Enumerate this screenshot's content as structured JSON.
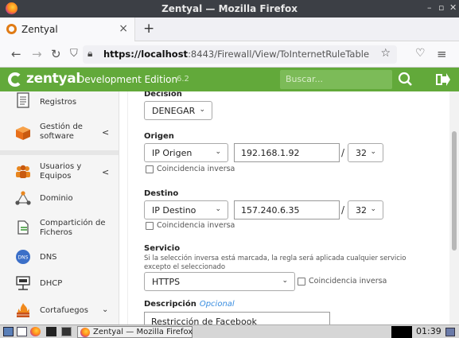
{
  "window": {
    "title": "Zentyal — Mozilla Firefox"
  },
  "browser": {
    "tab_label": "Zentyal",
    "tab_close": "×",
    "new_tab": "+",
    "url_host": "https://localhost",
    "url_path": ":8443/Firewall/View/ToInternetRuleTable"
  },
  "header": {
    "brand": "zentyal",
    "edition": "Development Edition",
    "version": "6.2",
    "search_placeholder": "Buscar..."
  },
  "sidebar": {
    "items": [
      {
        "label": "Registros",
        "icon": "registry-icon",
        "chevron": false
      },
      {
        "label": "Gestión de\nsoftware",
        "icon": "software-box-icon",
        "chevron": true
      },
      {
        "label": "Usuarios y\nEquipos",
        "icon": "users-icon",
        "chevron": true
      },
      {
        "label": "Dominio",
        "icon": "domain-network-icon",
        "chevron": false
      },
      {
        "label": "Compartición de\nFicheros",
        "icon": "file-share-icon",
        "chevron": false
      },
      {
        "label": "DNS",
        "icon": "dns-icon",
        "chevron": false
      },
      {
        "label": "DHCP",
        "icon": "dhcp-icon",
        "chevron": false
      },
      {
        "label": "Cortafuegos",
        "icon": "firewall-icon",
        "chevron": true
      }
    ]
  },
  "form": {
    "decision": {
      "label": "Decisión",
      "value": "DENEGAR"
    },
    "origen": {
      "label": "Origen",
      "type": "IP Origen",
      "ip": "192.168.1.92",
      "slash": "/",
      "mask": "32",
      "inverse_label": "Coincidencia inversa"
    },
    "destino": {
      "label": "Destino",
      "type": "IP Destino",
      "ip": "157.240.6.35",
      "slash": "/",
      "mask": "32",
      "inverse_label": "Coincidencia inversa"
    },
    "servicio": {
      "label": "Servicio",
      "help": "Si la selección inversa está marcada, la regla será aplicada cualquier servicio excepto el seleccionado",
      "value": "HTTPS",
      "inverse_label": "Coincidencia inversa"
    },
    "descripcion": {
      "label": "Descripción",
      "optional": "Opcional",
      "value": "Restricción de Facebook"
    }
  },
  "taskbar": {
    "task_label": "Zentyal — Mozilla Firefox",
    "clock": "01:39"
  },
  "colors": {
    "brand_green": "#62a93a",
    "link_blue": "#3a8ee0"
  }
}
